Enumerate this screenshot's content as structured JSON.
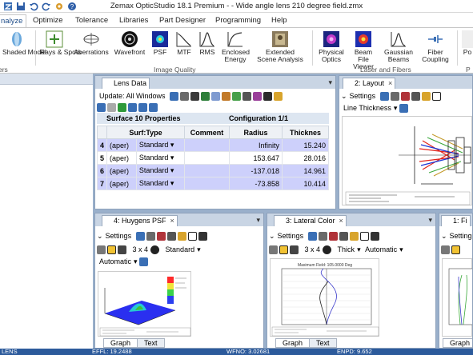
{
  "title": "Zemax OpticStudio 18.1     Premium -              - Wide angle lens 210 degree field.zmx",
  "ribbon_tabs": [
    "nalyze",
    "Optimize",
    "Tolerance",
    "Libraries",
    "Part Designer",
    "Programming",
    "Help"
  ],
  "ribbon": {
    "buttons": [
      "Shaded Model",
      "Rays & Spots",
      "Aberrations",
      "Wavefront",
      "PSF",
      "MTF",
      "RMS",
      "Enclosed Energy",
      "Extended Scene Analysis",
      "Physical Optics",
      "Beam File Viewer",
      "Gaussian Beams",
      "Fiber Coupling",
      "Po"
    ],
    "groups": [
      "ers",
      "Image Quality",
      "Laser and Fibers",
      "P"
    ]
  },
  "lens_data": {
    "tab": "Lens Data",
    "update": "Update: All Windows",
    "surface_props": "Surface 10 Properties",
    "configuration": "Configuration 1/1",
    "columns": [
      "Surf:Type",
      "Comment",
      "Radius",
      "Thicknes"
    ],
    "rows": [
      {
        "n": "4",
        "label": "(aper)",
        "type": "Standard",
        "comment": "",
        "radius": "Infinity",
        "thick": "15.240"
      },
      {
        "n": "5",
        "label": "(aper)",
        "type": "Standard",
        "comment": "",
        "radius": "153.647",
        "thick": "28.016"
      },
      {
        "n": "6",
        "label": "(aper)",
        "type": "Standard",
        "comment": "",
        "radius": "-137.018",
        "thick": "14.961"
      },
      {
        "n": "7",
        "label": "(aper)",
        "type": "Standard",
        "comment": "",
        "radius": "-73.858",
        "thick": "10.414"
      }
    ]
  },
  "layout": {
    "tab": "2: Layout",
    "settings": "Settings",
    "line_thickness": "Line Thickness"
  },
  "huygens": {
    "tab": "4: Huygens PSF",
    "settings": "Settings",
    "grid": "3 x 4",
    "mode": "Standard",
    "scale": "Automatic",
    "graph": "Graph",
    "text": "Text"
  },
  "lateral": {
    "tab": "3: Lateral Color",
    "settings": "Settings",
    "grid": "3 x 4",
    "thick": "Thick",
    "scale": "Automatic",
    "graph": "Graph",
    "text": "Text",
    "plot_title": "Maximum Field: 105.0000 Deg"
  },
  "fourth": {
    "tab": "1: Fi",
    "settings": "Setting",
    "graph": "Graph"
  },
  "status": {
    "a": "LENS",
    "b": "EFFL: 19.2488",
    "c": "WFNO: 3.02681",
    "d": "ENPD: 9.652"
  }
}
